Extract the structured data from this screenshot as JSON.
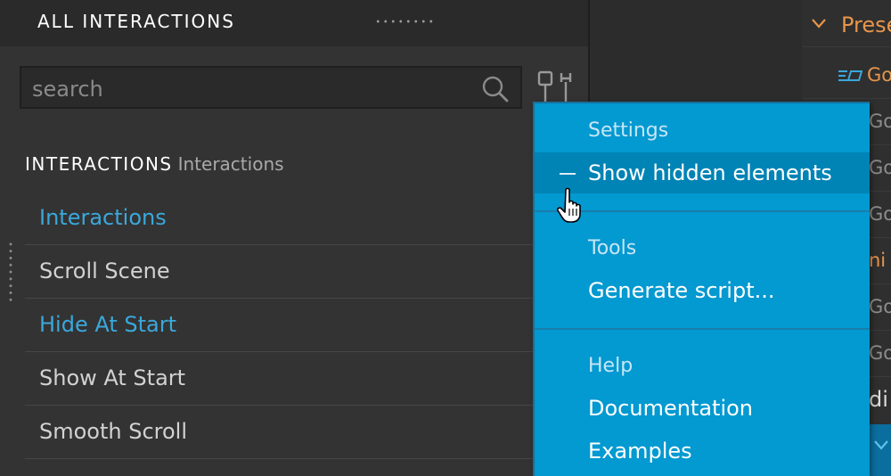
{
  "panel": {
    "title": "ALL INTERACTIONS",
    "search_placeholder": "search",
    "section_title": "INTERACTIONS",
    "section_subtitle": "Interactions"
  },
  "interactions": [
    {
      "label": "Interactions",
      "link": true
    },
    {
      "label": "Scroll Scene",
      "link": false
    },
    {
      "label": "Hide At Start",
      "link": true
    },
    {
      "label": "Show At Start",
      "link": false
    },
    {
      "label": "Smooth Scroll",
      "link": false
    }
  ],
  "menu": {
    "settings_heading": "Settings",
    "show_hidden": "Show hidden elements",
    "tools_heading": "Tools",
    "generate_script": "Generate script...",
    "help_heading": "Help",
    "documentation": "Documentation",
    "examples": "Examples"
  },
  "outline": {
    "rows": [
      "Prese",
      "Go",
      "Go",
      "Go",
      "Go",
      "ni",
      "Go",
      "Go",
      "di"
    ]
  },
  "colors": {
    "menu_bg": "#0399d1",
    "menu_highlight": "#0083b5",
    "link": "#3aa8dc",
    "accent_orange": "#e8954a"
  }
}
